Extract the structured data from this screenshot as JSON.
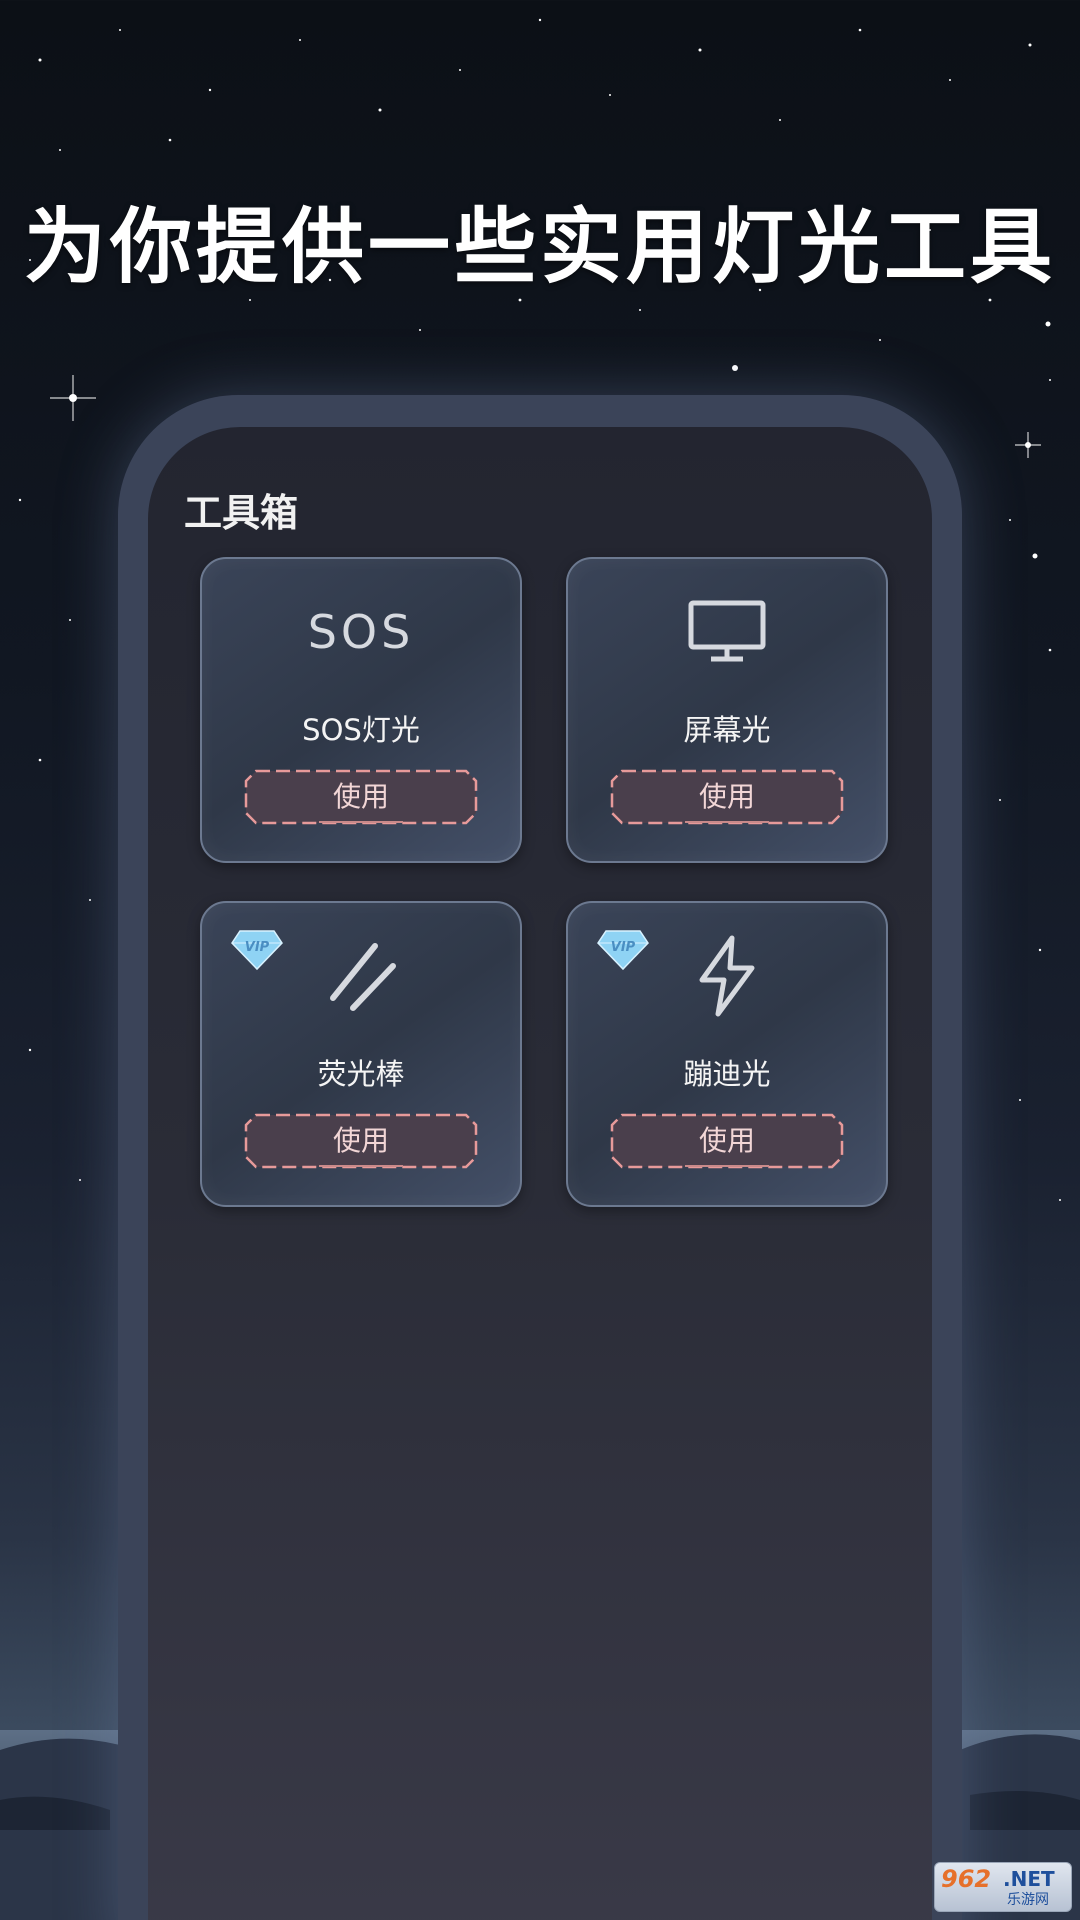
{
  "headline": "为你提供一些实用灯光工具",
  "toolbox": {
    "title": "工具箱",
    "cards": [
      {
        "label": "SOS灯光",
        "icon": "sos-icon",
        "icon_text": "SOS",
        "button": "使用",
        "vip": false
      },
      {
        "label": "屏幕光",
        "icon": "monitor-icon",
        "button": "使用",
        "vip": false
      },
      {
        "label": "荧光棒",
        "icon": "glow-stick-icon",
        "button": "使用",
        "vip": true,
        "vip_text": "VIP"
      },
      {
        "label": "蹦迪光",
        "icon": "lightning-icon",
        "button": "使用",
        "vip": true,
        "vip_text": "VIP"
      }
    ]
  },
  "watermark": {
    "top": "962",
    "net": ".NET",
    "bottom": "乐游网"
  },
  "colors": {
    "button_border": "#e79a9a",
    "button_fill": "#4a3f4c",
    "vip_gem": "#8fd3f4"
  }
}
